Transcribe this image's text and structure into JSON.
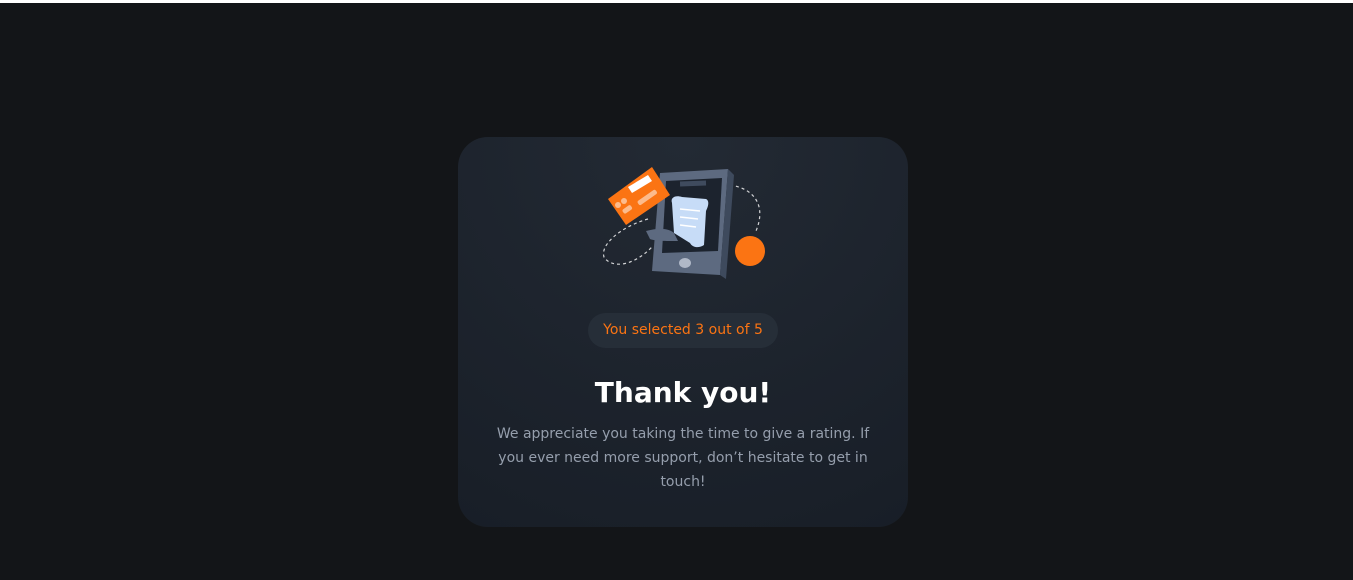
{
  "rating": {
    "selected_text": "You selected 3 out of 5",
    "selected_value": 3,
    "max_value": 5
  },
  "thank_you": {
    "title": "Thank you!",
    "message": "We appreciate you taking the time to give a rating. If you ever need more support, don’t hesitate to get in touch!"
  },
  "illustration": {
    "name": "thank-you-illustration",
    "icons": [
      "credit-card-icon",
      "phone-icon",
      "receipt-icon",
      "orange-dot-icon"
    ]
  },
  "colors": {
    "page_bg": "#131518",
    "card_bg": "#181e27",
    "accent": "#fb7413",
    "pill_bg": "#262e38",
    "title": "#ffffff",
    "body_text": "#959eac"
  }
}
